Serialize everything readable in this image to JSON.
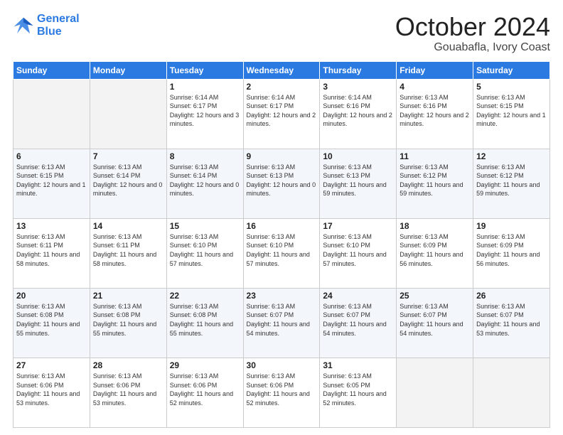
{
  "header": {
    "logo_line1": "General",
    "logo_line2": "Blue",
    "main_title": "October 2024",
    "subtitle": "Gouabafla, Ivory Coast"
  },
  "days_of_week": [
    "Sunday",
    "Monday",
    "Tuesday",
    "Wednesday",
    "Thursday",
    "Friday",
    "Saturday"
  ],
  "weeks": [
    [
      {
        "day": "",
        "info": ""
      },
      {
        "day": "",
        "info": ""
      },
      {
        "day": "1",
        "info": "Sunrise: 6:14 AM\nSunset: 6:17 PM\nDaylight: 12 hours and 3 minutes."
      },
      {
        "day": "2",
        "info": "Sunrise: 6:14 AM\nSunset: 6:17 PM\nDaylight: 12 hours and 2 minutes."
      },
      {
        "day": "3",
        "info": "Sunrise: 6:14 AM\nSunset: 6:16 PM\nDaylight: 12 hours and 2 minutes."
      },
      {
        "day": "4",
        "info": "Sunrise: 6:13 AM\nSunset: 6:16 PM\nDaylight: 12 hours and 2 minutes."
      },
      {
        "day": "5",
        "info": "Sunrise: 6:13 AM\nSunset: 6:15 PM\nDaylight: 12 hours and 1 minute."
      }
    ],
    [
      {
        "day": "6",
        "info": "Sunrise: 6:13 AM\nSunset: 6:15 PM\nDaylight: 12 hours and 1 minute."
      },
      {
        "day": "7",
        "info": "Sunrise: 6:13 AM\nSunset: 6:14 PM\nDaylight: 12 hours and 0 minutes."
      },
      {
        "day": "8",
        "info": "Sunrise: 6:13 AM\nSunset: 6:14 PM\nDaylight: 12 hours and 0 minutes."
      },
      {
        "day": "9",
        "info": "Sunrise: 6:13 AM\nSunset: 6:13 PM\nDaylight: 12 hours and 0 minutes."
      },
      {
        "day": "10",
        "info": "Sunrise: 6:13 AM\nSunset: 6:13 PM\nDaylight: 11 hours and 59 minutes."
      },
      {
        "day": "11",
        "info": "Sunrise: 6:13 AM\nSunset: 6:12 PM\nDaylight: 11 hours and 59 minutes."
      },
      {
        "day": "12",
        "info": "Sunrise: 6:13 AM\nSunset: 6:12 PM\nDaylight: 11 hours and 59 minutes."
      }
    ],
    [
      {
        "day": "13",
        "info": "Sunrise: 6:13 AM\nSunset: 6:11 PM\nDaylight: 11 hours and 58 minutes."
      },
      {
        "day": "14",
        "info": "Sunrise: 6:13 AM\nSunset: 6:11 PM\nDaylight: 11 hours and 58 minutes."
      },
      {
        "day": "15",
        "info": "Sunrise: 6:13 AM\nSunset: 6:10 PM\nDaylight: 11 hours and 57 minutes."
      },
      {
        "day": "16",
        "info": "Sunrise: 6:13 AM\nSunset: 6:10 PM\nDaylight: 11 hours and 57 minutes."
      },
      {
        "day": "17",
        "info": "Sunrise: 6:13 AM\nSunset: 6:10 PM\nDaylight: 11 hours and 57 minutes."
      },
      {
        "day": "18",
        "info": "Sunrise: 6:13 AM\nSunset: 6:09 PM\nDaylight: 11 hours and 56 minutes."
      },
      {
        "day": "19",
        "info": "Sunrise: 6:13 AM\nSunset: 6:09 PM\nDaylight: 11 hours and 56 minutes."
      }
    ],
    [
      {
        "day": "20",
        "info": "Sunrise: 6:13 AM\nSunset: 6:08 PM\nDaylight: 11 hours and 55 minutes."
      },
      {
        "day": "21",
        "info": "Sunrise: 6:13 AM\nSunset: 6:08 PM\nDaylight: 11 hours and 55 minutes."
      },
      {
        "day": "22",
        "info": "Sunrise: 6:13 AM\nSunset: 6:08 PM\nDaylight: 11 hours and 55 minutes."
      },
      {
        "day": "23",
        "info": "Sunrise: 6:13 AM\nSunset: 6:07 PM\nDaylight: 11 hours and 54 minutes."
      },
      {
        "day": "24",
        "info": "Sunrise: 6:13 AM\nSunset: 6:07 PM\nDaylight: 11 hours and 54 minutes."
      },
      {
        "day": "25",
        "info": "Sunrise: 6:13 AM\nSunset: 6:07 PM\nDaylight: 11 hours and 54 minutes."
      },
      {
        "day": "26",
        "info": "Sunrise: 6:13 AM\nSunset: 6:07 PM\nDaylight: 11 hours and 53 minutes."
      }
    ],
    [
      {
        "day": "27",
        "info": "Sunrise: 6:13 AM\nSunset: 6:06 PM\nDaylight: 11 hours and 53 minutes."
      },
      {
        "day": "28",
        "info": "Sunrise: 6:13 AM\nSunset: 6:06 PM\nDaylight: 11 hours and 53 minutes."
      },
      {
        "day": "29",
        "info": "Sunrise: 6:13 AM\nSunset: 6:06 PM\nDaylight: 11 hours and 52 minutes."
      },
      {
        "day": "30",
        "info": "Sunrise: 6:13 AM\nSunset: 6:06 PM\nDaylight: 11 hours and 52 minutes."
      },
      {
        "day": "31",
        "info": "Sunrise: 6:13 AM\nSunset: 6:05 PM\nDaylight: 11 hours and 52 minutes."
      },
      {
        "day": "",
        "info": ""
      },
      {
        "day": "",
        "info": ""
      }
    ]
  ]
}
